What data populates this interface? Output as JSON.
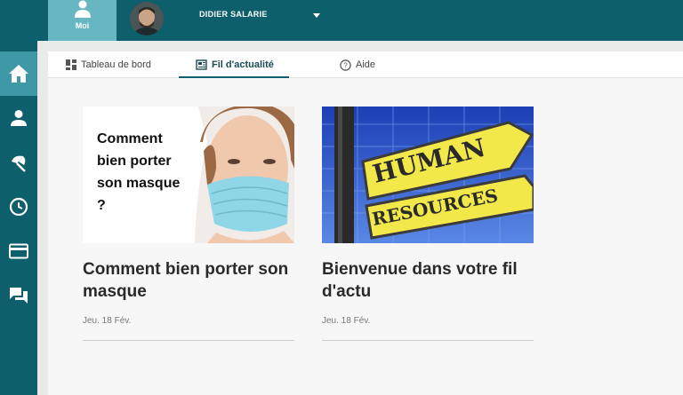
{
  "header": {
    "moi_label": "Moi",
    "user_name": "DIDIER SALARIE"
  },
  "sidebar": {
    "items": [
      {
        "icon": "home-icon",
        "active": true
      },
      {
        "icon": "user-icon"
      },
      {
        "icon": "beach-umbrella-icon"
      },
      {
        "icon": "clock-icon"
      },
      {
        "icon": "card-icon"
      },
      {
        "icon": "chat-icon"
      }
    ]
  },
  "tabs": [
    {
      "label": "Tableau de bord",
      "icon": "dashboard-icon"
    },
    {
      "label": "Fil d'actualité",
      "icon": "news-icon",
      "active": true
    },
    {
      "label": "Aide",
      "icon": "help-icon"
    }
  ],
  "cards": [
    {
      "title": "Comment bien porter son masque",
      "date": "Jeu. 18 Fév.",
      "image_text": "Comment bien porter son masque ?"
    },
    {
      "title": "Bienvenue dans votre fil d'actu",
      "date": "Jeu. 18 Fév.",
      "image_text_top": "HUMAN",
      "image_text_bottom": "RESOURCES"
    }
  ],
  "colors": {
    "primary": "#0d5f6b",
    "active_tab_bg": "#66b7c2",
    "active_side_bg": "#3e98a6"
  }
}
